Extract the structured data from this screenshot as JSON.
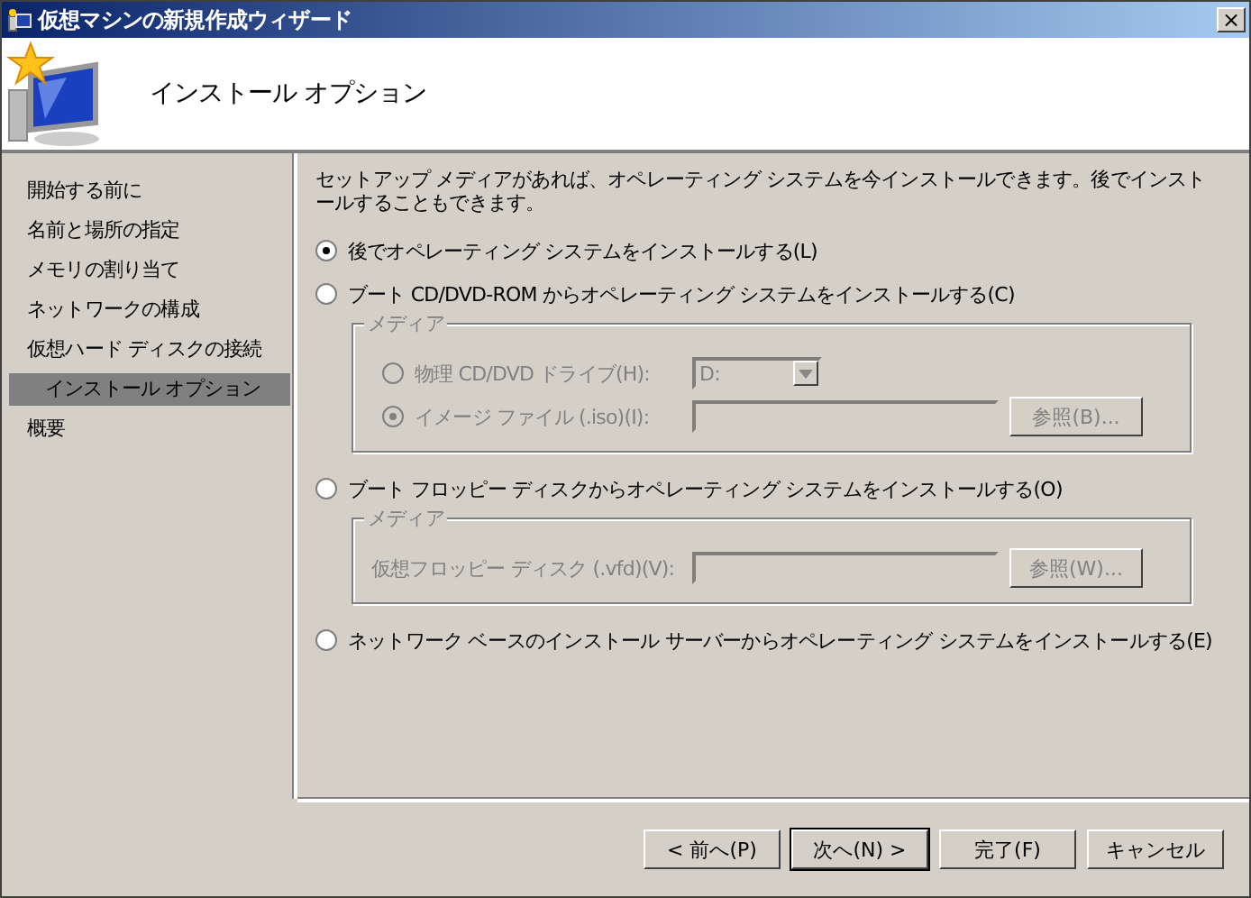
{
  "window": {
    "title": "仮想マシンの新規作成ウィザード",
    "close": "×"
  },
  "header": {
    "title": "インストール オプション"
  },
  "sidebar": {
    "items": [
      {
        "label": "開始する前に",
        "selected": false
      },
      {
        "label": "名前と場所の指定",
        "selected": false
      },
      {
        "label": "メモリの割り当て",
        "selected": false
      },
      {
        "label": "ネットワークの構成",
        "selected": false
      },
      {
        "label": "仮想ハード ディスクの接続",
        "selected": false
      },
      {
        "label": "インストール オプション",
        "selected": true
      },
      {
        "label": "概要",
        "selected": false
      }
    ]
  },
  "description": "セットアップ メディアがあれば、オペレーティング システムを今インストールできます。後でインストールすることもできます。",
  "options": [
    {
      "label": "後でオペレーティング システムをインストールする(L)",
      "selected": true
    },
    {
      "label": "ブート CD/DVD-ROM からオペレーティング システムをインストールする(C)",
      "selected": false,
      "media": {
        "legend": "メディア",
        "disabled": true,
        "rows": [
          {
            "kind": "radio",
            "label": "物理 CD/DVD ドライブ(H):",
            "selected": false,
            "field": {
              "kind": "dropdown",
              "value": "D:"
            }
          },
          {
            "kind": "radio",
            "label": "イメージ ファイル (.iso)(I):",
            "selected": true,
            "field": {
              "kind": "text"
            },
            "button": "参照(B)..."
          }
        ]
      }
    },
    {
      "label": "ブート フロッピー ディスクからオペレーティング システムをインストールする(O)",
      "selected": false,
      "media": {
        "legend": "メディア",
        "disabled": true,
        "rows": [
          {
            "kind": "label",
            "label": "仮想フロッピー ディスク (.vfd)(V):",
            "field": {
              "kind": "text"
            },
            "button": "参照(W)..."
          }
        ]
      }
    },
    {
      "label": "ネットワーク ベースのインストール サーバーからオペレーティング システムをインストールする(E)",
      "selected": false
    }
  ],
  "buttons": [
    {
      "label": "< 前へ(P)",
      "default": false
    },
    {
      "label": "次へ(N) >",
      "default": true
    },
    {
      "label": "完了(F)",
      "default": false
    },
    {
      "label": "キャンセル",
      "default": false
    }
  ]
}
